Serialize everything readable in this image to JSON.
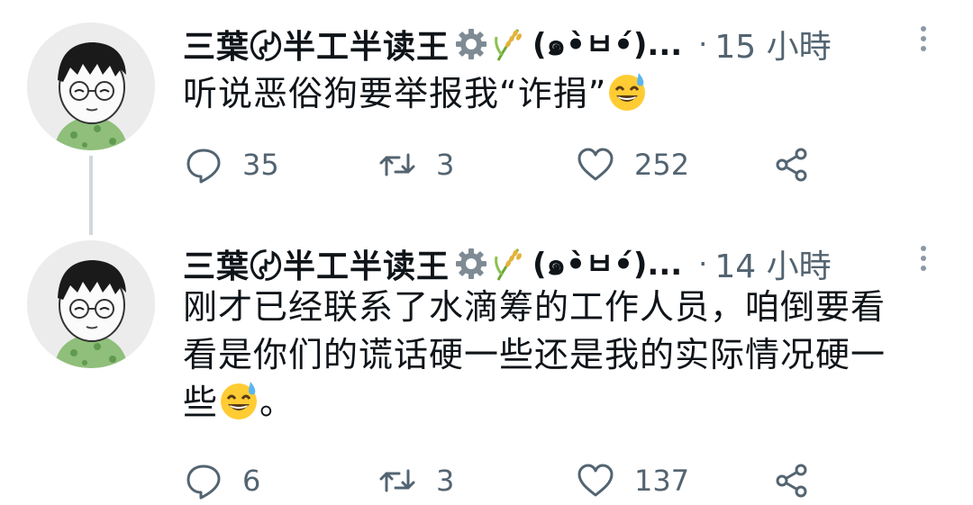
{
  "tweets": [
    {
      "author_name": "三葉〄半工半读王",
      "kaomoji": "(๑•̀ㅂ•́)...",
      "separator": "·",
      "time": "15 小時",
      "text": "听说恶俗狗要举报我“诈捐”",
      "emoji": "grinning-sweat-emoji",
      "replies": "35",
      "retweets": "3",
      "likes": "252"
    },
    {
      "author_name": "三葉〄半工半读王",
      "kaomoji": "(๑•̀ㅂ•́)...",
      "separator": "·",
      "time": "14 小時",
      "text_lines": [
        "刚才已经联系了水滴筹的工作人员，咱倒要看",
        "看是你们的谎话硬一些还是我的实际情况硬一",
        "些"
      ],
      "text_tail": "。",
      "emoji": "grinning-sweat-emoji",
      "replies": "6",
      "retweets": "3",
      "likes": "137"
    }
  ],
  "icons": {
    "badge": "gear-icon",
    "badge2": "rice-plant-icon",
    "more": "more-vertical-icon",
    "reply": "reply-bubble-icon",
    "retweet": "retweet-icon",
    "like": "heart-icon",
    "share": "share-icon"
  },
  "colors": {
    "text": "#0f1419",
    "secondary": "#536471",
    "thread_line": "#cfd9de"
  }
}
